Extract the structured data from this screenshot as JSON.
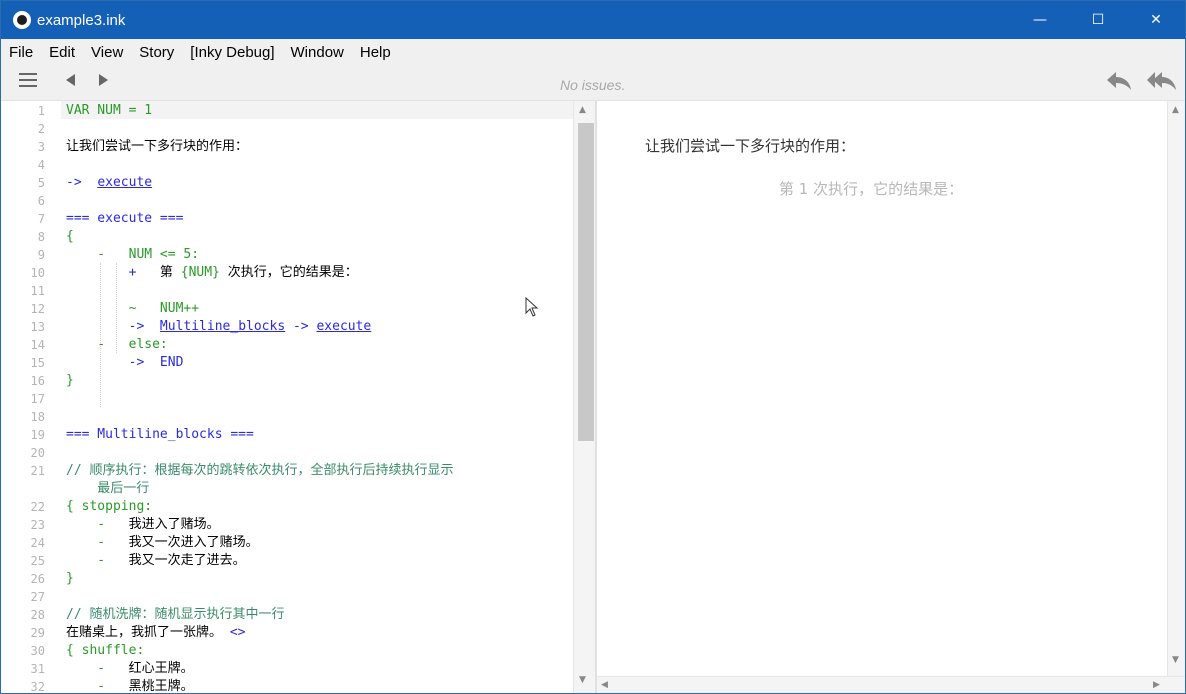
{
  "window": {
    "title": "example3.ink",
    "controls": {
      "minimize": "—",
      "maximize": "☐",
      "close": "✕"
    }
  },
  "menu": {
    "items": [
      "File",
      "Edit",
      "View",
      "Story",
      "[Inky Debug]",
      "Window",
      "Help"
    ]
  },
  "toolbar": {
    "status": "No issues.",
    "icons": {
      "menu": "hamburger-icon",
      "back": "back-arrow-icon",
      "forward": "forward-arrow-icon",
      "rewind_one": "rewind-icon",
      "rewind_all": "rewind-all-icon"
    }
  },
  "editor": {
    "lines": [
      {
        "n": "1",
        "segs": [
          {
            "t": "VAR NUM = 1",
            "c": "c-green"
          }
        ]
      },
      {
        "n": "2",
        "segs": []
      },
      {
        "n": "3",
        "segs": [
          {
            "t": "让我们尝试一下多行块的作用：",
            "c": "c-black"
          }
        ]
      },
      {
        "n": "4",
        "segs": []
      },
      {
        "n": "5",
        "segs": [
          {
            "t": "->  ",
            "c": "c-blue"
          },
          {
            "t": "execute",
            "c": "c-link"
          }
        ]
      },
      {
        "n": "6",
        "segs": []
      },
      {
        "n": "7",
        "segs": [
          {
            "t": "=== execute ===",
            "c": "c-blue"
          }
        ]
      },
      {
        "n": "8",
        "segs": [
          {
            "t": "{",
            "c": "c-green"
          }
        ]
      },
      {
        "n": "9",
        "segs": [
          {
            "t": "    -   NUM <= 5:",
            "c": "c-green"
          }
        ]
      },
      {
        "n": "10",
        "segs": [
          {
            "t": "        +   ",
            "c": "c-blue"
          },
          {
            "t": "第 ",
            "c": "c-black"
          },
          {
            "t": "{NUM}",
            "c": "c-green"
          },
          {
            "t": " 次执行，它的结果是：",
            "c": "c-black"
          }
        ]
      },
      {
        "n": "11",
        "segs": []
      },
      {
        "n": "12",
        "segs": [
          {
            "t": "        ~   NUM++",
            "c": "c-green"
          }
        ]
      },
      {
        "n": "13",
        "segs": [
          {
            "t": "        ->  ",
            "c": "c-blue"
          },
          {
            "t": "Multiline_blocks",
            "c": "c-link"
          },
          {
            "t": " -> ",
            "c": "c-blue"
          },
          {
            "t": "execute",
            "c": "c-link"
          }
        ]
      },
      {
        "n": "14",
        "segs": [
          {
            "t": "    -   else:",
            "c": "c-green"
          }
        ]
      },
      {
        "n": "15",
        "segs": [
          {
            "t": "        ->  END",
            "c": "c-blue"
          }
        ]
      },
      {
        "n": "16",
        "segs": [
          {
            "t": "}",
            "c": "c-green"
          }
        ]
      },
      {
        "n": "17",
        "segs": []
      },
      {
        "n": "18",
        "segs": []
      },
      {
        "n": "19",
        "segs": [
          {
            "t": "=== Multiline_blocks ===",
            "c": "c-blue"
          }
        ]
      },
      {
        "n": "20",
        "segs": []
      },
      {
        "n": "21",
        "segs": [
          {
            "t": "// 顺序执行：根据每次的跳转依次执行，全部执行后持续执行显示",
            "c": "c-comment"
          }
        ]
      },
      {
        "n": "",
        "segs": [
          {
            "t": "    最后一行",
            "c": "c-comment"
          }
        ]
      },
      {
        "n": "22",
        "segs": [
          {
            "t": "{ stopping:",
            "c": "c-green"
          }
        ]
      },
      {
        "n": "23",
        "segs": [
          {
            "t": "    -   ",
            "c": "c-green"
          },
          {
            "t": "我进入了赌场。",
            "c": "c-black"
          }
        ]
      },
      {
        "n": "24",
        "segs": [
          {
            "t": "    -   ",
            "c": "c-green"
          },
          {
            "t": "我又一次进入了赌场。",
            "c": "c-black"
          }
        ]
      },
      {
        "n": "25",
        "segs": [
          {
            "t": "    -   ",
            "c": "c-green"
          },
          {
            "t": "我又一次走了进去。",
            "c": "c-black"
          }
        ]
      },
      {
        "n": "26",
        "segs": [
          {
            "t": "}",
            "c": "c-green"
          }
        ]
      },
      {
        "n": "27",
        "segs": []
      },
      {
        "n": "28",
        "segs": [
          {
            "t": "// 随机洗牌：随机显示执行其中一行",
            "c": "c-comment"
          }
        ]
      },
      {
        "n": "29",
        "segs": [
          {
            "t": "在赌桌上，我抓了一张牌。 ",
            "c": "c-black"
          },
          {
            "t": "<>",
            "c": "c-blue"
          }
        ]
      },
      {
        "n": "30",
        "segs": [
          {
            "t": "{ shuffle:",
            "c": "c-green"
          }
        ]
      },
      {
        "n": "31",
        "segs": [
          {
            "t": "    -   ",
            "c": "c-green"
          },
          {
            "t": "红心王牌。",
            "c": "c-black"
          }
        ]
      },
      {
        "n": "32",
        "segs": [
          {
            "t": "    -   ",
            "c": "c-green"
          },
          {
            "t": "黑桃王牌。",
            "c": "c-black"
          }
        ]
      }
    ]
  },
  "player": {
    "paragraphs": [
      "让我们尝试一下多行块的作用：",
      "第 1 次执行，它的结果是："
    ]
  },
  "colors": {
    "titlebar": "#1560b7",
    "keyword_green": "#2a9a2a",
    "divert_blue": "#2a2ae0",
    "comment": "#3a8a6a"
  }
}
